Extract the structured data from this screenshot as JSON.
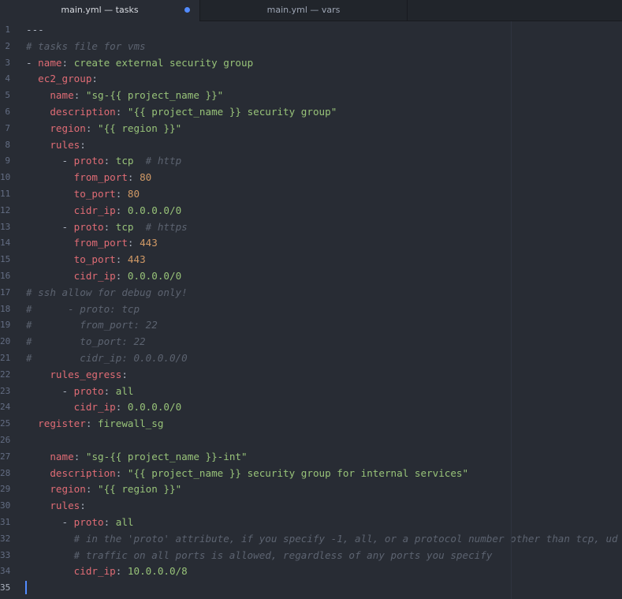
{
  "tabs": [
    {
      "label": "main.yml — tasks",
      "active": true,
      "modified": true
    },
    {
      "label": "main.yml — vars",
      "active": false,
      "modified": false
    }
  ],
  "lines": [
    {
      "n": "1",
      "tokens": [
        {
          "t": "---",
          "c": "plain"
        }
      ]
    },
    {
      "n": "2",
      "tokens": [
        {
          "t": "# tasks file for vms",
          "c": "comment"
        }
      ]
    },
    {
      "n": "3",
      "tokens": [
        {
          "t": "- ",
          "c": "plain"
        },
        {
          "t": "name",
          "c": "key"
        },
        {
          "t": ": ",
          "c": "plain"
        },
        {
          "t": "create external security group",
          "c": "str"
        }
      ]
    },
    {
      "n": "4",
      "tokens": [
        {
          "t": "  ",
          "c": "plain"
        },
        {
          "t": "ec2_group",
          "c": "key"
        },
        {
          "t": ":",
          "c": "plain"
        }
      ]
    },
    {
      "n": "5",
      "tokens": [
        {
          "t": "    ",
          "c": "plain"
        },
        {
          "t": "name",
          "c": "key"
        },
        {
          "t": ": ",
          "c": "plain"
        },
        {
          "t": "\"sg-{{ project_name }}\"",
          "c": "str"
        }
      ]
    },
    {
      "n": "6",
      "tokens": [
        {
          "t": "    ",
          "c": "plain"
        },
        {
          "t": "description",
          "c": "key"
        },
        {
          "t": ": ",
          "c": "plain"
        },
        {
          "t": "\"{{ project_name }} security group\"",
          "c": "str"
        }
      ]
    },
    {
      "n": "7",
      "tokens": [
        {
          "t": "    ",
          "c": "plain"
        },
        {
          "t": "region",
          "c": "key"
        },
        {
          "t": ": ",
          "c": "plain"
        },
        {
          "t": "\"{{ region }}\"",
          "c": "str"
        }
      ]
    },
    {
      "n": "8",
      "tokens": [
        {
          "t": "    ",
          "c": "plain"
        },
        {
          "t": "rules",
          "c": "key"
        },
        {
          "t": ":",
          "c": "plain"
        }
      ]
    },
    {
      "n": "9",
      "tokens": [
        {
          "t": "      - ",
          "c": "plain"
        },
        {
          "t": "proto",
          "c": "key"
        },
        {
          "t": ": ",
          "c": "plain"
        },
        {
          "t": "tcp",
          "c": "str"
        },
        {
          "t": "  # http",
          "c": "comment"
        }
      ]
    },
    {
      "n": "10",
      "tokens": [
        {
          "t": "        ",
          "c": "plain"
        },
        {
          "t": "from_port",
          "c": "key"
        },
        {
          "t": ": ",
          "c": "plain"
        },
        {
          "t": "80",
          "c": "num"
        }
      ]
    },
    {
      "n": "11",
      "tokens": [
        {
          "t": "        ",
          "c": "plain"
        },
        {
          "t": "to_port",
          "c": "key"
        },
        {
          "t": ": ",
          "c": "plain"
        },
        {
          "t": "80",
          "c": "num"
        }
      ]
    },
    {
      "n": "12",
      "tokens": [
        {
          "t": "        ",
          "c": "plain"
        },
        {
          "t": "cidr_ip",
          "c": "key"
        },
        {
          "t": ": ",
          "c": "plain"
        },
        {
          "t": "0.0.0.0/0",
          "c": "str"
        }
      ]
    },
    {
      "n": "13",
      "tokens": [
        {
          "t": "      - ",
          "c": "plain"
        },
        {
          "t": "proto",
          "c": "key"
        },
        {
          "t": ": ",
          "c": "plain"
        },
        {
          "t": "tcp",
          "c": "str"
        },
        {
          "t": "  # https",
          "c": "comment"
        }
      ]
    },
    {
      "n": "14",
      "tokens": [
        {
          "t": "        ",
          "c": "plain"
        },
        {
          "t": "from_port",
          "c": "key"
        },
        {
          "t": ": ",
          "c": "plain"
        },
        {
          "t": "443",
          "c": "num"
        }
      ]
    },
    {
      "n": "15",
      "tokens": [
        {
          "t": "        ",
          "c": "plain"
        },
        {
          "t": "to_port",
          "c": "key"
        },
        {
          "t": ": ",
          "c": "plain"
        },
        {
          "t": "443",
          "c": "num"
        }
      ]
    },
    {
      "n": "16",
      "tokens": [
        {
          "t": "        ",
          "c": "plain"
        },
        {
          "t": "cidr_ip",
          "c": "key"
        },
        {
          "t": ": ",
          "c": "plain"
        },
        {
          "t": "0.0.0.0/0",
          "c": "str"
        }
      ]
    },
    {
      "n": "17",
      "tokens": [
        {
          "t": "# ssh allow for debug only!",
          "c": "comment"
        }
      ]
    },
    {
      "n": "18",
      "tokens": [
        {
          "t": "#      - proto: tcp",
          "c": "comment"
        }
      ]
    },
    {
      "n": "19",
      "tokens": [
        {
          "t": "#        from_port: 22",
          "c": "comment"
        }
      ]
    },
    {
      "n": "20",
      "tokens": [
        {
          "t": "#        to_port: 22",
          "c": "comment"
        }
      ]
    },
    {
      "n": "21",
      "tokens": [
        {
          "t": "#        cidr_ip: 0.0.0.0/0",
          "c": "comment"
        }
      ]
    },
    {
      "n": "22",
      "tokens": [
        {
          "t": "    ",
          "c": "plain"
        },
        {
          "t": "rules_egress",
          "c": "key"
        },
        {
          "t": ":",
          "c": "plain"
        }
      ]
    },
    {
      "n": "23",
      "tokens": [
        {
          "t": "      - ",
          "c": "plain"
        },
        {
          "t": "proto",
          "c": "key"
        },
        {
          "t": ": ",
          "c": "plain"
        },
        {
          "t": "all",
          "c": "str"
        }
      ]
    },
    {
      "n": "24",
      "tokens": [
        {
          "t": "        ",
          "c": "plain"
        },
        {
          "t": "cidr_ip",
          "c": "key"
        },
        {
          "t": ": ",
          "c": "plain"
        },
        {
          "t": "0.0.0.0/0",
          "c": "str"
        }
      ]
    },
    {
      "n": "25",
      "tokens": [
        {
          "t": "  ",
          "c": "plain"
        },
        {
          "t": "register",
          "c": "key"
        },
        {
          "t": ": ",
          "c": "plain"
        },
        {
          "t": "firewall_sg",
          "c": "str"
        }
      ]
    },
    {
      "n": "26",
      "tokens": []
    },
    {
      "n": "27",
      "tokens": [
        {
          "t": "    ",
          "c": "plain"
        },
        {
          "t": "name",
          "c": "key"
        },
        {
          "t": ": ",
          "c": "plain"
        },
        {
          "t": "\"sg-{{ project_name }}-int\"",
          "c": "str"
        }
      ]
    },
    {
      "n": "28",
      "tokens": [
        {
          "t": "    ",
          "c": "plain"
        },
        {
          "t": "description",
          "c": "key"
        },
        {
          "t": ": ",
          "c": "plain"
        },
        {
          "t": "\"{{ project_name }} security group for internal services\"",
          "c": "str"
        }
      ]
    },
    {
      "n": "29",
      "tokens": [
        {
          "t": "    ",
          "c": "plain"
        },
        {
          "t": "region",
          "c": "key"
        },
        {
          "t": ": ",
          "c": "plain"
        },
        {
          "t": "\"{{ region }}\"",
          "c": "str"
        }
      ]
    },
    {
      "n": "30",
      "tokens": [
        {
          "t": "    ",
          "c": "plain"
        },
        {
          "t": "rules",
          "c": "key"
        },
        {
          "t": ":",
          "c": "plain"
        }
      ]
    },
    {
      "n": "31",
      "tokens": [
        {
          "t": "      - ",
          "c": "plain"
        },
        {
          "t": "proto",
          "c": "key"
        },
        {
          "t": ": ",
          "c": "plain"
        },
        {
          "t": "all",
          "c": "str"
        }
      ]
    },
    {
      "n": "32",
      "tokens": [
        {
          "t": "        # in the 'proto' attribute, if you specify -1, all, or a protocol number other than tcp, ud",
          "c": "comment"
        }
      ]
    },
    {
      "n": "33",
      "tokens": [
        {
          "t": "        # traffic on all ports is allowed, regardless of any ports you specify",
          "c": "comment"
        }
      ]
    },
    {
      "n": "34",
      "tokens": [
        {
          "t": "        ",
          "c": "plain"
        },
        {
          "t": "cidr_ip",
          "c": "key"
        },
        {
          "t": ": ",
          "c": "plain"
        },
        {
          "t": "10.0.0.0/8",
          "c": "str"
        }
      ]
    },
    {
      "n": "35",
      "tokens": [],
      "current": true
    }
  ]
}
